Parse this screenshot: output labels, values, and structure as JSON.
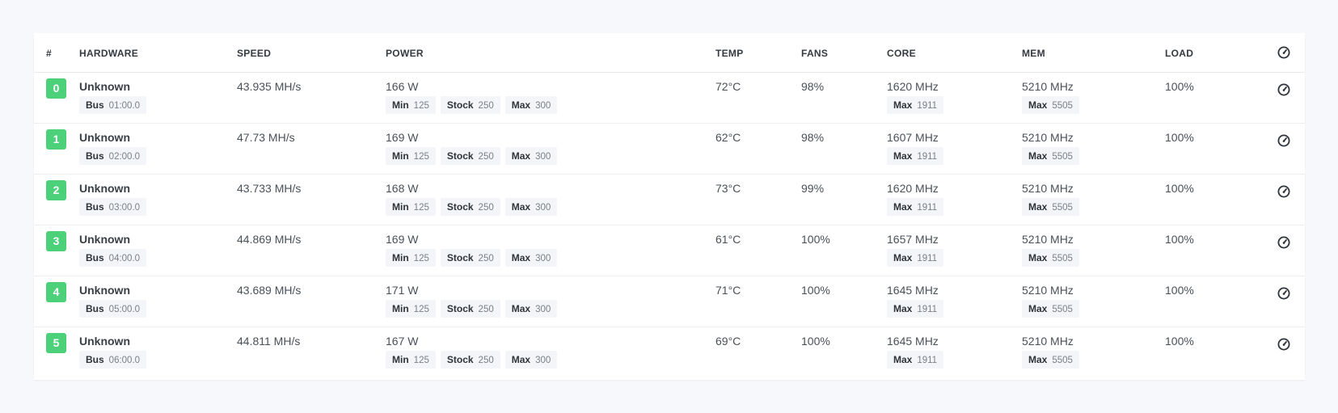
{
  "headers": {
    "idx": "#",
    "hardware": "HARDWARE",
    "speed": "SPEED",
    "power": "POWER",
    "temp": "TEMP",
    "fans": "FANS",
    "core": "CORE",
    "mem": "MEM",
    "load": "LOAD",
    "action_icon": "gauge-icon"
  },
  "labels": {
    "bus": "Bus",
    "min": "Min",
    "stock": "Stock",
    "max": "Max"
  },
  "colors": {
    "index_badge": "#4cd07a",
    "background": "#f7f8fb"
  },
  "gpus": [
    {
      "index": "0",
      "name": "Unknown",
      "bus": "01:00.0",
      "speed": "43.935 MH/s",
      "power": "166 W",
      "power_min": "125",
      "power_stock": "250",
      "power_max": "300",
      "temp": "72°C",
      "fans": "98%",
      "core": "1620 MHz",
      "core_max": "1911",
      "mem": "5210 MHz",
      "mem_max": "5505",
      "load": "100%"
    },
    {
      "index": "1",
      "name": "Unknown",
      "bus": "02:00.0",
      "speed": "47.73 MH/s",
      "power": "169 W",
      "power_min": "125",
      "power_stock": "250",
      "power_max": "300",
      "temp": "62°C",
      "fans": "98%",
      "core": "1607 MHz",
      "core_max": "1911",
      "mem": "5210 MHz",
      "mem_max": "5505",
      "load": "100%"
    },
    {
      "index": "2",
      "name": "Unknown",
      "bus": "03:00.0",
      "speed": "43.733 MH/s",
      "power": "168 W",
      "power_min": "125",
      "power_stock": "250",
      "power_max": "300",
      "temp": "73°C",
      "fans": "99%",
      "core": "1620 MHz",
      "core_max": "1911",
      "mem": "5210 MHz",
      "mem_max": "5505",
      "load": "100%"
    },
    {
      "index": "3",
      "name": "Unknown",
      "bus": "04:00.0",
      "speed": "44.869 MH/s",
      "power": "169 W",
      "power_min": "125",
      "power_stock": "250",
      "power_max": "300",
      "temp": "61°C",
      "fans": "100%",
      "core": "1657 MHz",
      "core_max": "1911",
      "mem": "5210 MHz",
      "mem_max": "5505",
      "load": "100%"
    },
    {
      "index": "4",
      "name": "Unknown",
      "bus": "05:00.0",
      "speed": "43.689 MH/s",
      "power": "171 W",
      "power_min": "125",
      "power_stock": "250",
      "power_max": "300",
      "temp": "71°C",
      "fans": "100%",
      "core": "1645 MHz",
      "core_max": "1911",
      "mem": "5210 MHz",
      "mem_max": "5505",
      "load": "100%"
    },
    {
      "index": "5",
      "name": "Unknown",
      "bus": "06:00.0",
      "speed": "44.811 MH/s",
      "power": "167 W",
      "power_min": "125",
      "power_stock": "250",
      "power_max": "300",
      "temp": "69°C",
      "fans": "100%",
      "core": "1645 MHz",
      "core_max": "1911",
      "mem": "5210 MHz",
      "mem_max": "5505",
      "load": "100%"
    }
  ]
}
